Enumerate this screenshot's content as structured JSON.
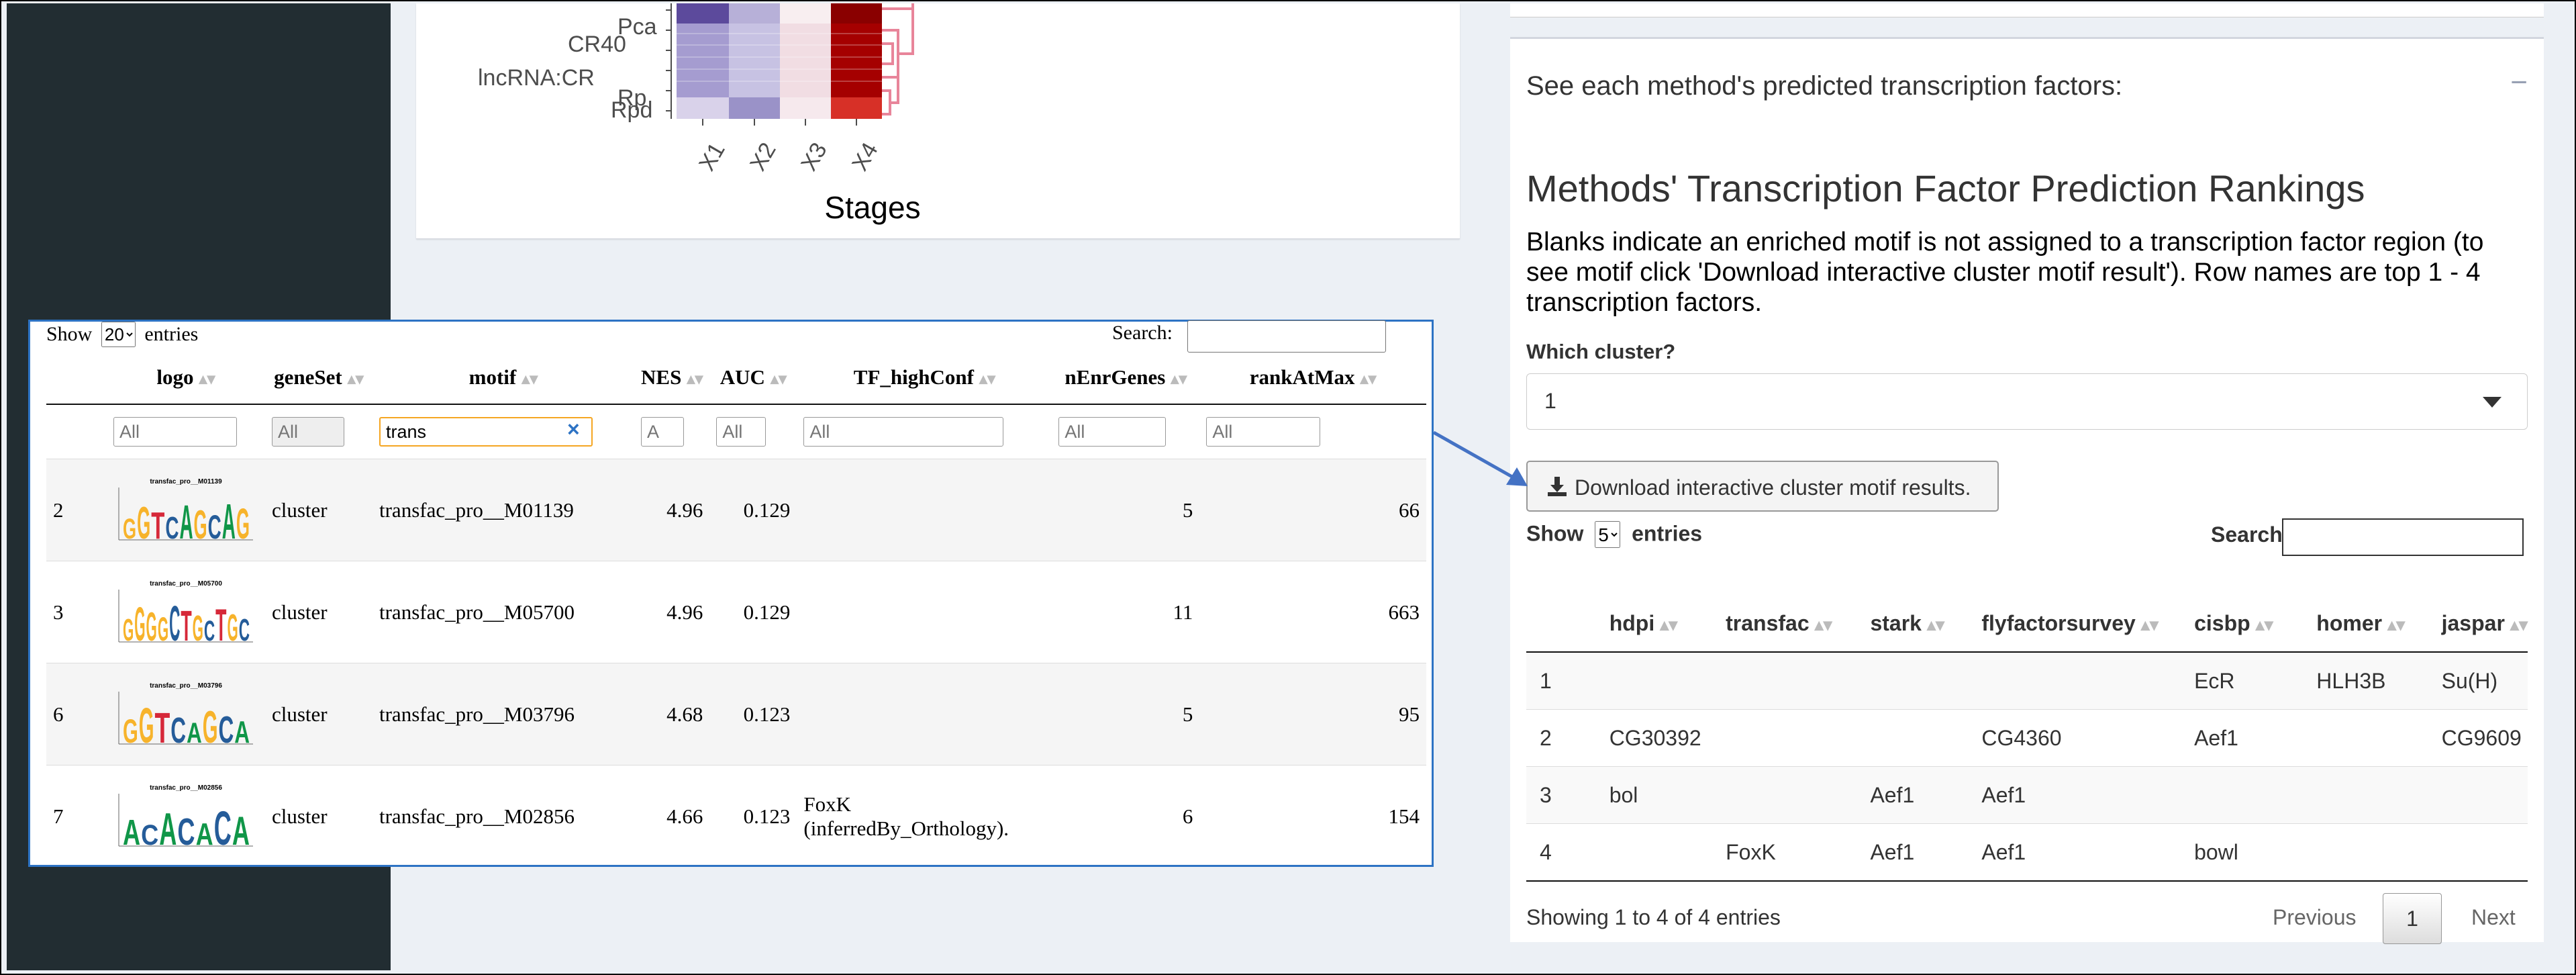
{
  "heatmap": {
    "row_labels": [
      "CR40",
      "lncRNA:CR",
      "Rp",
      "Pca",
      "Rpd"
    ],
    "x_ticks": [
      "X1",
      "X2",
      "X3",
      "X4"
    ],
    "x_title": "Stages",
    "colors": {
      "dark_purple": "#5c4a9c",
      "light_purple": "#b7b0d8",
      "pale": "#f5e6ea",
      "dark_red": "#a50000",
      "dendro": "#e8859a"
    }
  },
  "right_panel": {
    "header": "See each method's predicted transcription factors:",
    "collapse_icon": "−",
    "title": "Methods' Transcription Factor Prediction Rankings",
    "description": "Blanks indicate an enriched motif is not assigned to a transcription factor region (to see motif click 'Download interactive cluster motif result'). Row names are top 1 - 4 transcription factors.",
    "cluster_label": "Which cluster?",
    "cluster_value": "1",
    "download_label": "Download interactive cluster motif results.",
    "show_label": "Show",
    "show_value": "5",
    "entries_label": "entries",
    "search_label": "Search:",
    "columns": [
      "",
      "hdpi",
      "transfac",
      "stark",
      "flyfactorsurvey",
      "cisbp",
      "homer",
      "jaspar"
    ],
    "rows": [
      [
        "1",
        "",
        "",
        "",
        "",
        "EcR",
        "HLH3B",
        "Su(H)"
      ],
      [
        "2",
        "CG30392",
        "",
        "",
        "CG4360",
        "Aef1",
        "",
        "CG9609"
      ],
      [
        "3",
        "bol",
        "",
        "Aef1",
        "Aef1",
        "",
        "",
        ""
      ],
      [
        "4",
        "",
        "FoxK",
        "Aef1",
        "Aef1",
        "bowl",
        "",
        ""
      ]
    ],
    "info": "Showing 1 to 4 of 4 entries",
    "prev_label": "Previous",
    "page_label": "1",
    "next_label": "Next"
  },
  "left_panel": {
    "show_label": "Show",
    "show_value": "20",
    "entries_label": "entries",
    "search_label": "Search:",
    "columns": [
      "",
      "logo",
      "geneSet",
      "motif",
      "NES",
      "AUC",
      "TF_highConf",
      "nEnrGenes",
      "rankAtMax"
    ],
    "filters": {
      "logo": "All",
      "geneSet": "All",
      "motif": "trans",
      "NES": "A",
      "AUC": "All",
      "TF_highConf": "All",
      "nEnrGenes": "All",
      "rankAtMax": "All"
    },
    "clear_icon": "×",
    "rows": [
      {
        "idx": "2",
        "logo_title": "transfac_pro__M01139",
        "logo_seq": "GGTCAGCAG",
        "geneSet": "cluster",
        "motif": "transfac_pro__M01139",
        "NES": "4.96",
        "AUC": "0.129",
        "TF_highConf": "",
        "nEnrGenes": "5",
        "rankAtMax": "66"
      },
      {
        "idx": "3",
        "logo_title": "transfac_pro__M05700",
        "logo_seq": "GGGGCTGCTGC",
        "geneSet": "cluster",
        "motif": "transfac_pro__M05700",
        "NES": "4.96",
        "AUC": "0.129",
        "TF_highConf": "",
        "nEnrGenes": "11",
        "rankAtMax": "663"
      },
      {
        "idx": "6",
        "logo_title": "transfac_pro__M03796",
        "logo_seq": "GGTCAGCA",
        "geneSet": "cluster",
        "motif": "transfac_pro__M03796",
        "NES": "4.68",
        "AUC": "0.123",
        "TF_highConf": "",
        "nEnrGenes": "5",
        "rankAtMax": "95"
      },
      {
        "idx": "7",
        "logo_title": "transfac_pro__M02856",
        "logo_seq": "ACACACA",
        "geneSet": "cluster",
        "motif": "transfac_pro__M02856",
        "NES": "4.66",
        "AUC": "0.123",
        "TF_highConf": "FoxK (inferredBy_Orthology).",
        "nEnrGenes": "6",
        "rankAtMax": "154"
      }
    ]
  }
}
